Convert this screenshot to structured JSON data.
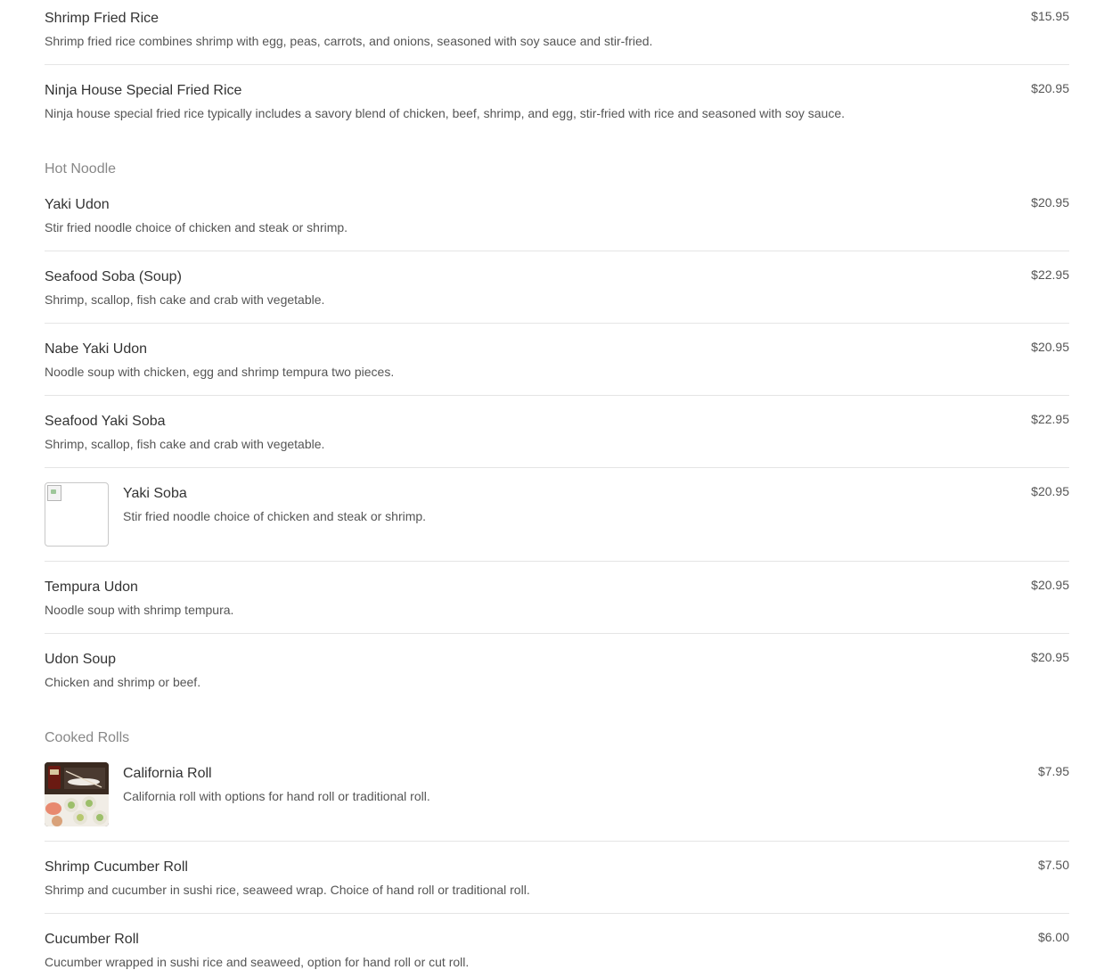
{
  "sections": [
    {
      "title": "Hot Noodle",
      "key": "hot_noodle"
    },
    {
      "title": "Cooked Rolls",
      "key": "cooked_rolls"
    }
  ],
  "items": [
    {
      "name": "Shrimp Fried Rice",
      "description": "Shrimp fried rice combines shrimp with egg, peas, carrots, and onions, seasoned with soy sauce and stir-fried.",
      "price": "$15.95"
    },
    {
      "name": "Ninja House Special Fried Rice",
      "description": "Ninja house special fried rice typically includes a savory blend of chicken, beef, shrimp, and egg, stir-fried with rice and seasoned with soy sauce.",
      "price": "$20.95"
    },
    {
      "name": "Yaki Udon",
      "description": "Stir fried noodle choice of chicken and steak or shrimp.",
      "price": "$20.95"
    },
    {
      "name": "Seafood Soba (Soup)",
      "description": "Shrimp, scallop, fish cake and crab with vegetable.",
      "price": "$22.95"
    },
    {
      "name": "Nabe Yaki Udon",
      "description": "Noodle soup with chicken, egg and shrimp tempura two pieces.",
      "price": "$20.95"
    },
    {
      "name": "Seafood Yaki Soba",
      "description": "Shrimp, scallop, fish cake and crab with vegetable.",
      "price": "$22.95"
    },
    {
      "name": "Yaki Soba",
      "description": "Stir fried noodle choice of chicken and steak or shrimp.",
      "price": "$20.95",
      "image": "broken-image-icon"
    },
    {
      "name": "Tempura Udon",
      "description": "Noodle soup with shrimp tempura.",
      "price": "$20.95"
    },
    {
      "name": "Udon Soup",
      "description": "Chicken and shrimp or beef.",
      "price": "$20.95"
    },
    {
      "name": "California Roll",
      "description": "California roll with options for hand roll or traditional roll.",
      "price": "$7.95",
      "image": "sushi-photo"
    },
    {
      "name": "Shrimp Cucumber Roll",
      "description": "Shrimp and cucumber in sushi rice, seaweed wrap. Choice of hand roll or traditional roll.",
      "price": "$7.50"
    },
    {
      "name": "Cucumber Roll",
      "description": "Cucumber wrapped in sushi rice and seaweed, option for hand roll or cut roll.",
      "price": "$6.00"
    }
  ],
  "colors": {
    "name": "#333333",
    "description": "#555555",
    "section_title": "#888888",
    "divider": "#e5e5e5"
  }
}
